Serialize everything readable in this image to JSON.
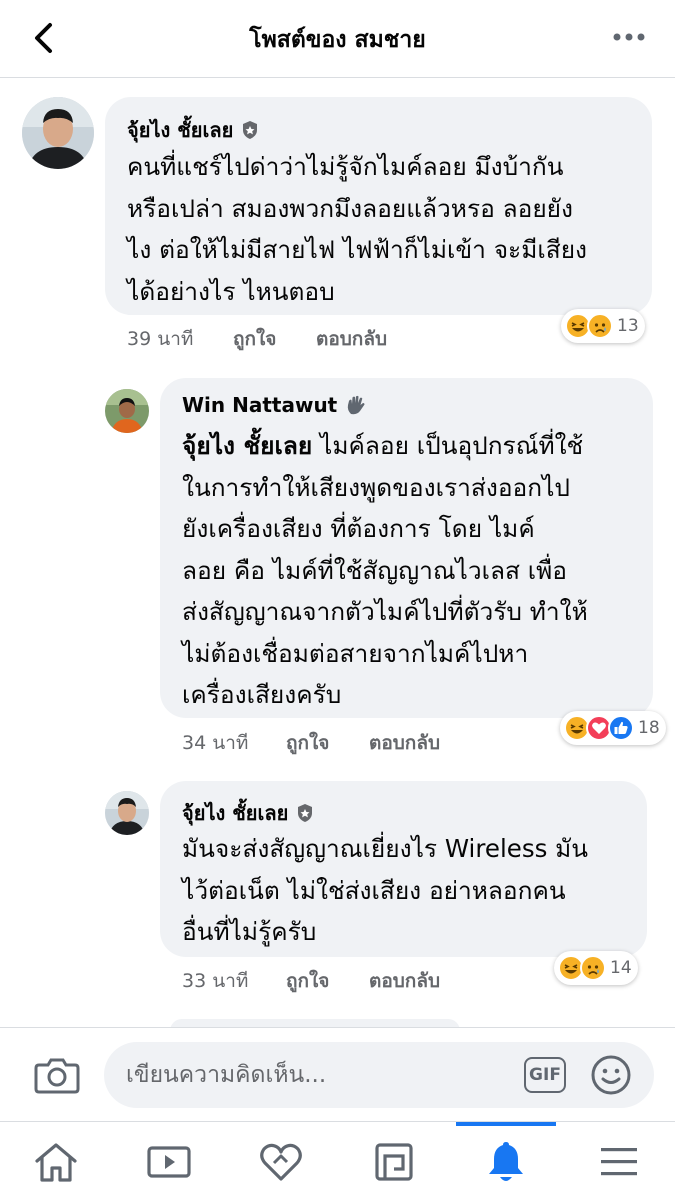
{
  "header": {
    "title": "โพสต์ของ สมชาย",
    "back_icon": "back-arrow-icon",
    "more_icon": "more-dots-icon"
  },
  "comments": [
    {
      "author": "จุ้ยไง ชั้ยเลย",
      "badge_icon": "shield-badge-icon",
      "text": "คนที่แชร์ไปด่าว่าไม่รู้จักไมค์ลอย มึงบ้ากัน\nหรือเปล่า สมองพวกมึงลอยแล้วหรอ ลอยยัง\nไง ต่อให้ไม่มีสายไฟ ไฟฟ้าก็ไม่เข้า จะมีเสียง\nได้อย่างไร ไหนตอบ",
      "time": "39 นาที",
      "like_label": "ถูกใจ",
      "reply_label": "ตอบกลับ",
      "reactions": [
        "laugh",
        "sad"
      ],
      "reaction_count": "13"
    },
    {
      "author": "Win Nattawut",
      "badge_icon": "wave-hand-icon",
      "mention": "จุ้ยไง ชั้ยเลย",
      "text": " ไมค์ลอย เป็นอุปกรณ์ที่ใช้\nในการทำให้เสียงพูดของเราส่งออกไป\nยังเครื่องเสียง ที่ต้องการ  โดย ไมค์\nลอย คือ ไมค์ที่ใช้สัญญาณไวเลส เพื่อ\nส่งสัญญาณจากตัวไมค์ไปที่ตัวรับ ทำให้\nไม่ต้องเชื่อมต่อสายจากไมค์ไปหา\nเครื่องเสียงครับ",
      "time": "34 นาที",
      "like_label": "ถูกใจ",
      "reply_label": "ตอบกลับ",
      "reactions": [
        "laugh",
        "love",
        "like"
      ],
      "reaction_count": "18"
    },
    {
      "author": "จุ้ยไง ชั้ยเลย",
      "badge_icon": "shield-badge-icon",
      "text": "มันจะส่งสัญญาณเยี่ยงไร Wireless มัน\nไว้ต่อเน็ต ไม่ใช่ส่งเสียง อย่าหลอกคน\nอื่นที่ไม่รู้ครับ",
      "time": "33 นาที",
      "like_label": "ถูกใจ",
      "reply_label": "ตอบกลับ",
      "reactions": [
        "laugh",
        "sad"
      ],
      "reaction_count": "14"
    }
  ],
  "composer": {
    "placeholder": "เขียนความคิดเห็น...",
    "gif_label": "GIF",
    "camera_icon": "camera-icon",
    "sticker_icon": "smiley-icon"
  },
  "bottom_nav": {
    "items": [
      "home-icon",
      "video-icon",
      "heart-icon",
      "marketplace-icon",
      "bell-icon",
      "menu-icon"
    ],
    "active": "bell-icon"
  },
  "colors": {
    "accent": "#1877f2",
    "bubble": "#f0f2f5",
    "meta_text": "#65676b",
    "laugh": "#f7b125",
    "love": "#f33e58",
    "like": "#1877f2"
  }
}
